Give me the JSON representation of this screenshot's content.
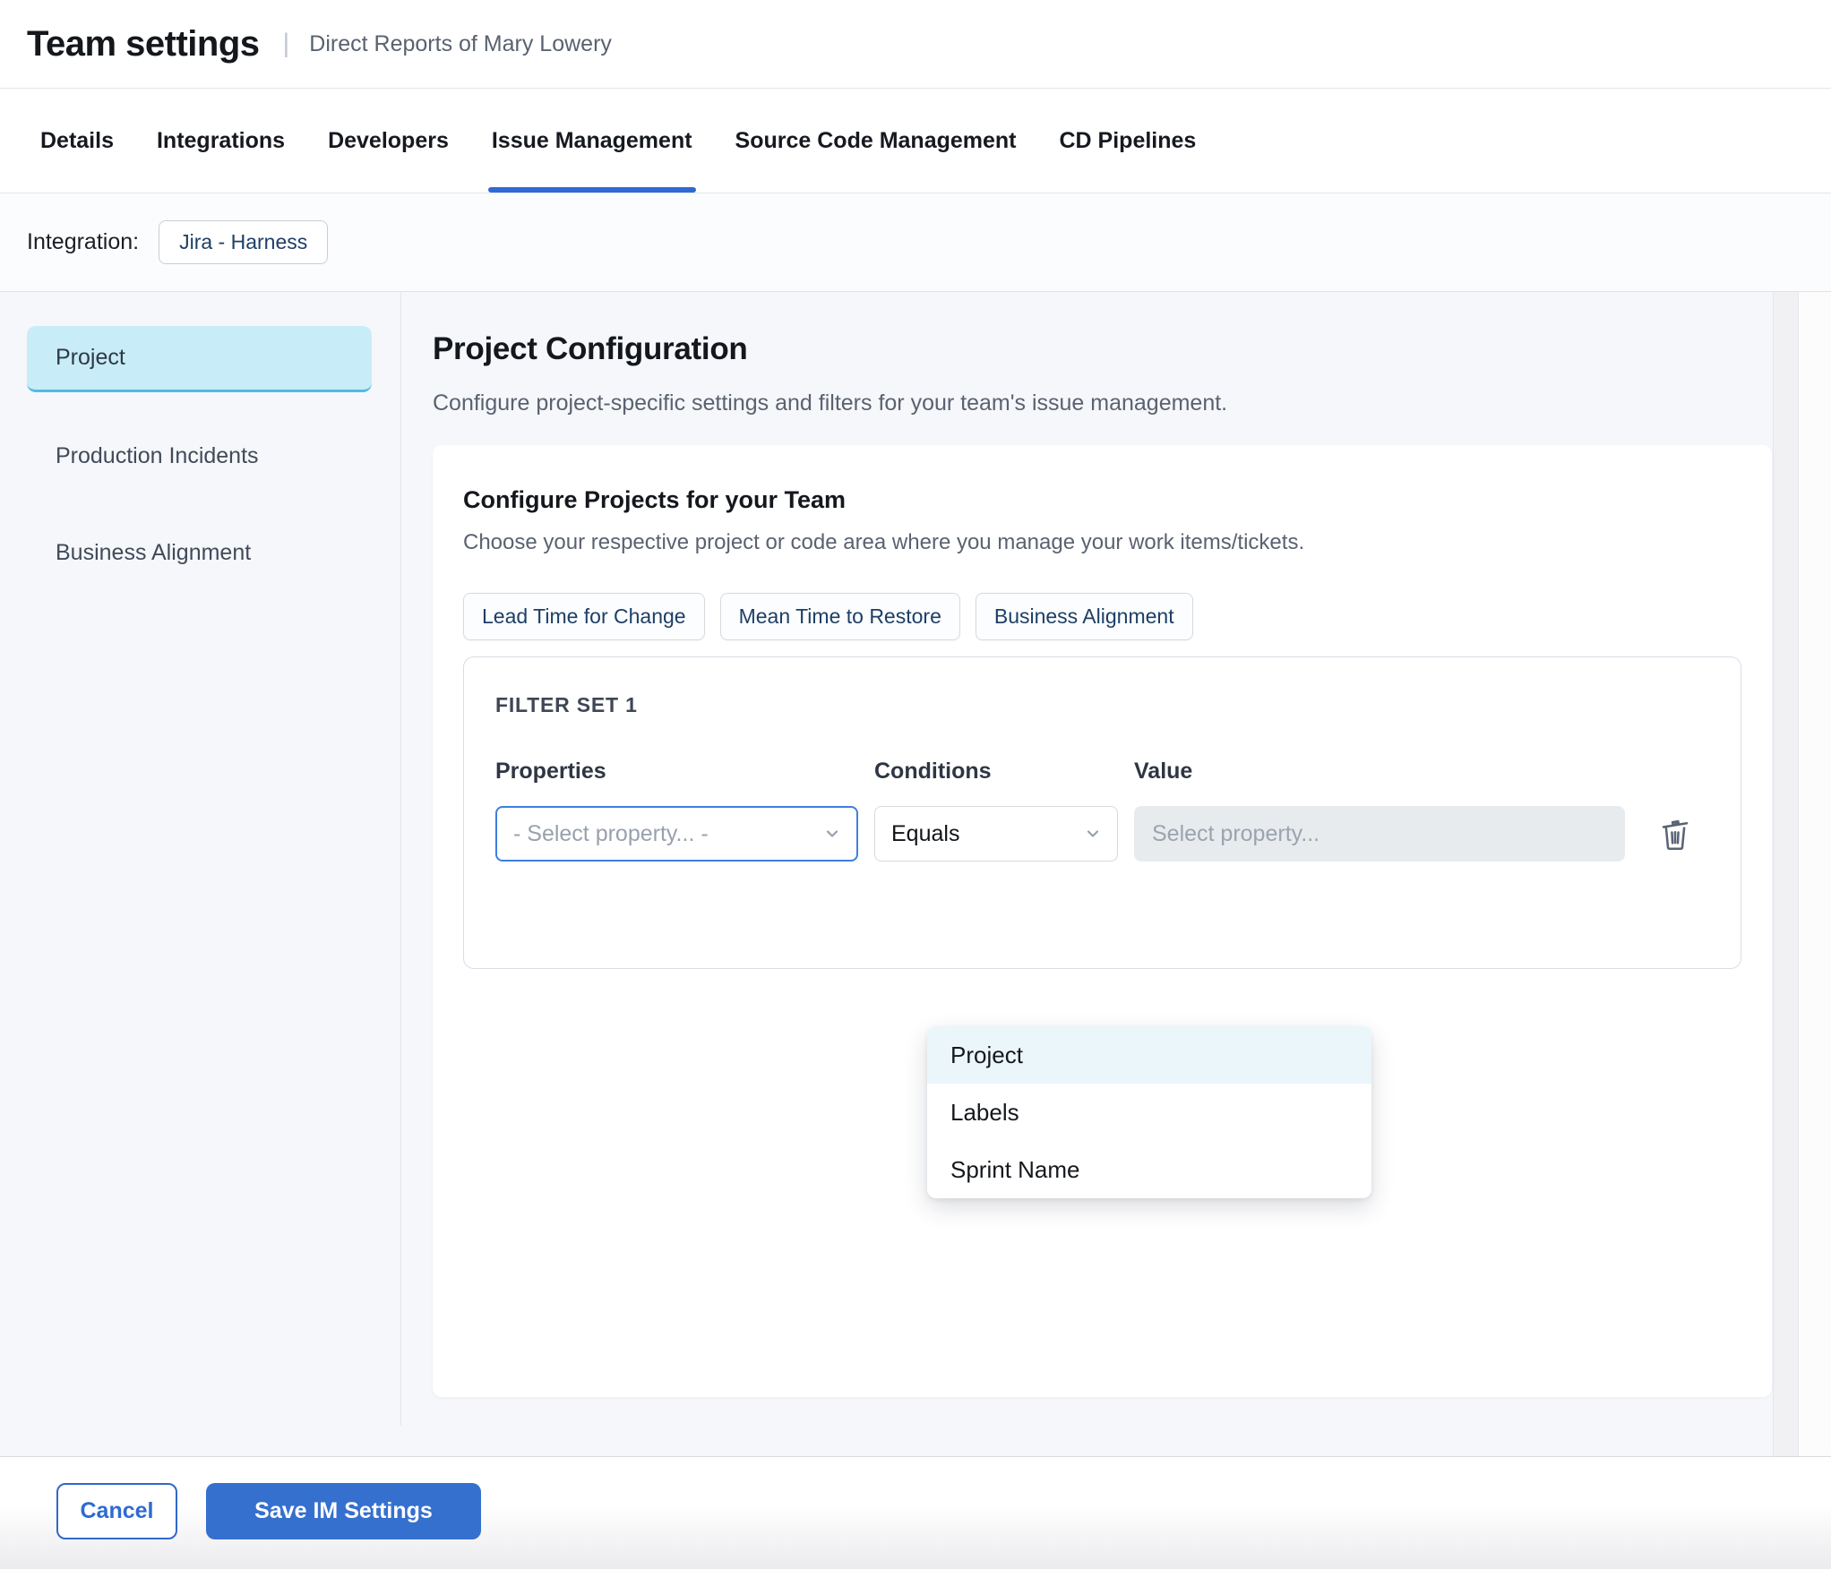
{
  "header": {
    "title": "Team settings",
    "separator": "|",
    "subtitle": "Direct Reports of Mary Lowery"
  },
  "tabs": [
    {
      "label": "Details",
      "active": false
    },
    {
      "label": "Integrations",
      "active": false
    },
    {
      "label": "Developers",
      "active": false
    },
    {
      "label": "Issue Management",
      "active": true
    },
    {
      "label": "Source Code Management",
      "active": false
    },
    {
      "label": "CD Pipelines",
      "active": false
    }
  ],
  "integration": {
    "label": "Integration:",
    "value": "Jira - Harness"
  },
  "sidebar": {
    "items": [
      {
        "label": "Project",
        "active": true
      },
      {
        "label": "Production Incidents",
        "active": false
      },
      {
        "label": "Business Alignment",
        "active": false
      }
    ]
  },
  "main": {
    "title": "Project Configuration",
    "description": "Configure project-specific settings and filters for your team's issue management.",
    "card": {
      "title": "Configure Projects for your Team",
      "description": "Choose your respective project or code area where you manage your work items/tickets.",
      "chips": [
        "Lead Time for Change",
        "Mean Time to Restore",
        "Business Alignment"
      ],
      "filter_set": {
        "title": "FILTER SET 1",
        "columns": [
          "Properties",
          "Conditions",
          "Value"
        ],
        "property_placeholder": "- Select property... -",
        "condition_value": "Equals",
        "value_placeholder": "Select property...",
        "dropdown_options": [
          "Project",
          "Labels",
          "Sprint Name"
        ],
        "highlighted_option": "Project"
      }
    }
  },
  "footer": {
    "cancel_label": "Cancel",
    "save_label": "Save IM Settings"
  },
  "colors": {
    "accent_blue": "#3069d6",
    "save_bg": "#3570cf",
    "focus_border": "#3d7ede",
    "sidebar_active_bg": "#c9ecf9",
    "sidebar_active_border": "#4fbde2",
    "chip_text": "#1d3f66",
    "dropdown_highlight": "#ebf6fb"
  }
}
